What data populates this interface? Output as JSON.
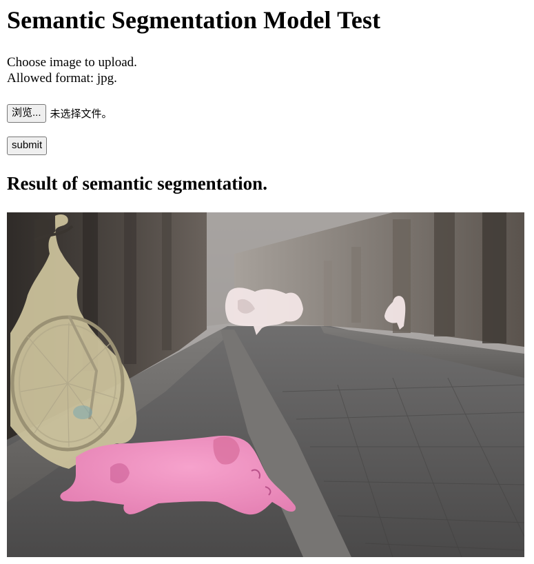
{
  "page": {
    "title": "Semantic Segmentation Model Test",
    "instructions": {
      "line1": "Choose image to upload.",
      "line2": "Allowed format: jpg."
    }
  },
  "upload": {
    "browse_label": "浏览...",
    "file_status": "未选择文件。",
    "submit_label": "submit"
  },
  "result": {
    "heading": "Result of semantic segmentation.",
    "segments": [
      "person",
      "bicycle",
      "dog",
      "person"
    ],
    "colors": {
      "dog_mask": "#f08cc0",
      "bicycle_mask": "#d2c8a0",
      "person_mask": "#f2e6e6"
    }
  }
}
